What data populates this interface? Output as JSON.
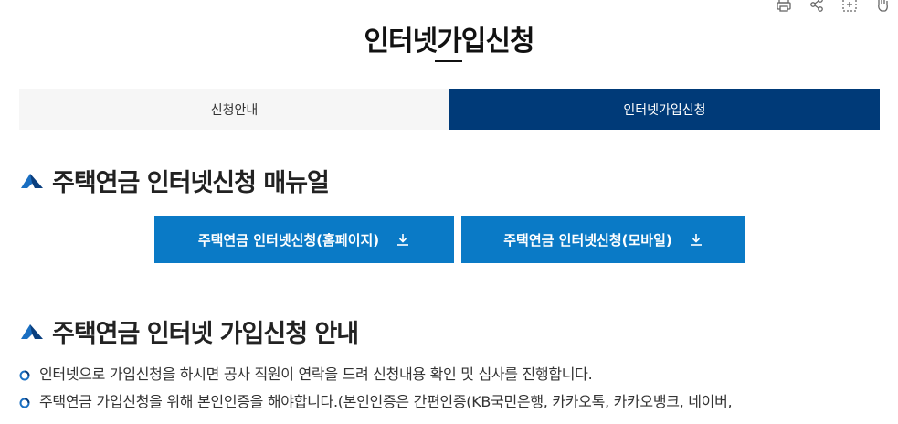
{
  "header": {
    "title": "인터넷가입신청",
    "utility_icons": [
      "print-icon",
      "share-icon",
      "zoom-icon",
      "hand-icon"
    ]
  },
  "tabs": [
    {
      "label": "신청안내",
      "active": false
    },
    {
      "label": "인터넷가입신청",
      "active": true
    }
  ],
  "manual_section": {
    "title": "주택연금 인터넷신청 매뉴얼",
    "buttons": [
      {
        "label": "주택연금 인터넷신청(홈페이지)",
        "icon": "download-icon"
      },
      {
        "label": "주택연금 인터넷신청(모바일)",
        "icon": "download-icon"
      }
    ]
  },
  "guide_section": {
    "title": "주택연금 인터넷 가입신청 안내",
    "items": [
      "인터넷으로 가입신청을 하시면 공사 직원이 연락을 드려 신청내용 확인 및 심사를 진행합니다.",
      "주택연금 가입신청을 위해 본인인증을 해야합니다.(본인인증은 간편인증(KB국민은행, 카카오톡, 카카오뱅크, 네이버,"
    ]
  },
  "colors": {
    "active_tab": "#003a78",
    "button": "#0a7ac6",
    "inactive_tab": "#f6f6f6"
  }
}
